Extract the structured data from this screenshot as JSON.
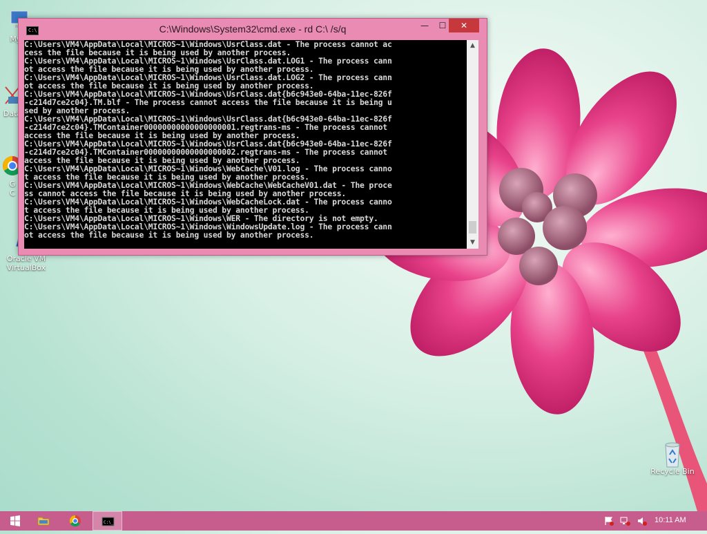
{
  "desktop": {
    "icons": [
      {
        "label": "My C",
        "icon": "computer-icon"
      },
      {
        "label": "Data",
        "icon": "network-icon"
      },
      {
        "label": "G",
        "label2": "C",
        "icon": "chrome-icon"
      },
      {
        "label": "Oracle VM",
        "label2": "VirtualBox",
        "icon": "virtualbox-icon"
      },
      {
        "label": "Recycle Bin",
        "icon": "recycle-bin-icon"
      }
    ]
  },
  "window": {
    "title": "C:\\Windows\\System32\\cmd.exe - rd  C:\\ /s/q",
    "controls": {
      "minimize": "—",
      "maximize": "☐",
      "close": "✕"
    },
    "console_lines": [
      "C:\\Users\\VM4\\AppData\\Local\\MICROS~1\\Windows\\UsrClass.dat - The process cannot ac",
      "cess the file because it is being used by another process.",
      "C:\\Users\\VM4\\AppData\\Local\\MICROS~1\\Windows\\UsrClass.dat.LOG1 - The process cann",
      "ot access the file because it is being used by another process.",
      "C:\\Users\\VM4\\AppData\\Local\\MICROS~1\\Windows\\UsrClass.dat.LOG2 - The process cann",
      "ot access the file because it is being used by another process.",
      "C:\\Users\\VM4\\AppData\\Local\\MICROS~1\\Windows\\UsrClass.dat{b6c943e0-64ba-11ec-826f",
      "-c214d7ce2c04}.TM.blf - The process cannot access the file because it is being u",
      "sed by another process.",
      "C:\\Users\\VM4\\AppData\\Local\\MICROS~1\\Windows\\UsrClass.dat{b6c943e0-64ba-11ec-826f",
      "-c214d7ce2c04}.TMContainer00000000000000000001.regtrans-ms - The process cannot",
      "access the file because it is being used by another process.",
      "C:\\Users\\VM4\\AppData\\Local\\MICROS~1\\Windows\\UsrClass.dat{b6c943e0-64ba-11ec-826f",
      "-c214d7ce2c04}.TMContainer00000000000000000002.regtrans-ms - The process cannot",
      "access the file because it is being used by another process.",
      "C:\\Users\\VM4\\AppData\\Local\\MICROS~1\\Windows\\WebCache\\V01.log - The process canno",
      "t access the file because it is being used by another process.",
      "C:\\Users\\VM4\\AppData\\Local\\MICROS~1\\Windows\\WebCache\\WebCacheV01.dat - The proce",
      "ss cannot access the file because it is being used by another process.",
      "C:\\Users\\VM4\\AppData\\Local\\MICROS~1\\Windows\\WebCacheLock.dat - The process canno",
      "t access the file because it is being used by another process.",
      "C:\\Users\\VM4\\AppData\\Local\\MICROS~1\\Windows\\WER - The directory is not empty.",
      "C:\\Users\\VM4\\AppData\\Local\\MICROS~1\\Windows\\WindowsUpdate.log - The process cann",
      "ot access the file because it is being used by another process."
    ]
  },
  "taskbar": {
    "items": [
      {
        "name": "start-button",
        "icon": "windows-logo-icon"
      },
      {
        "name": "file-explorer",
        "icon": "folder-icon"
      },
      {
        "name": "chrome",
        "icon": "chrome-icon"
      },
      {
        "name": "cmd",
        "icon": "cmd-icon",
        "active": true
      }
    ],
    "tray": [
      "action-center-flag-icon",
      "network-icon",
      "volume-muted-icon"
    ],
    "clock": "10:11 AM"
  },
  "colors": {
    "taskbar": "#c75d8d",
    "window_frame": "#e98bb2",
    "close_button": "#c7383d",
    "console_bg": "#000000",
    "console_text": "#d8d8d8"
  }
}
